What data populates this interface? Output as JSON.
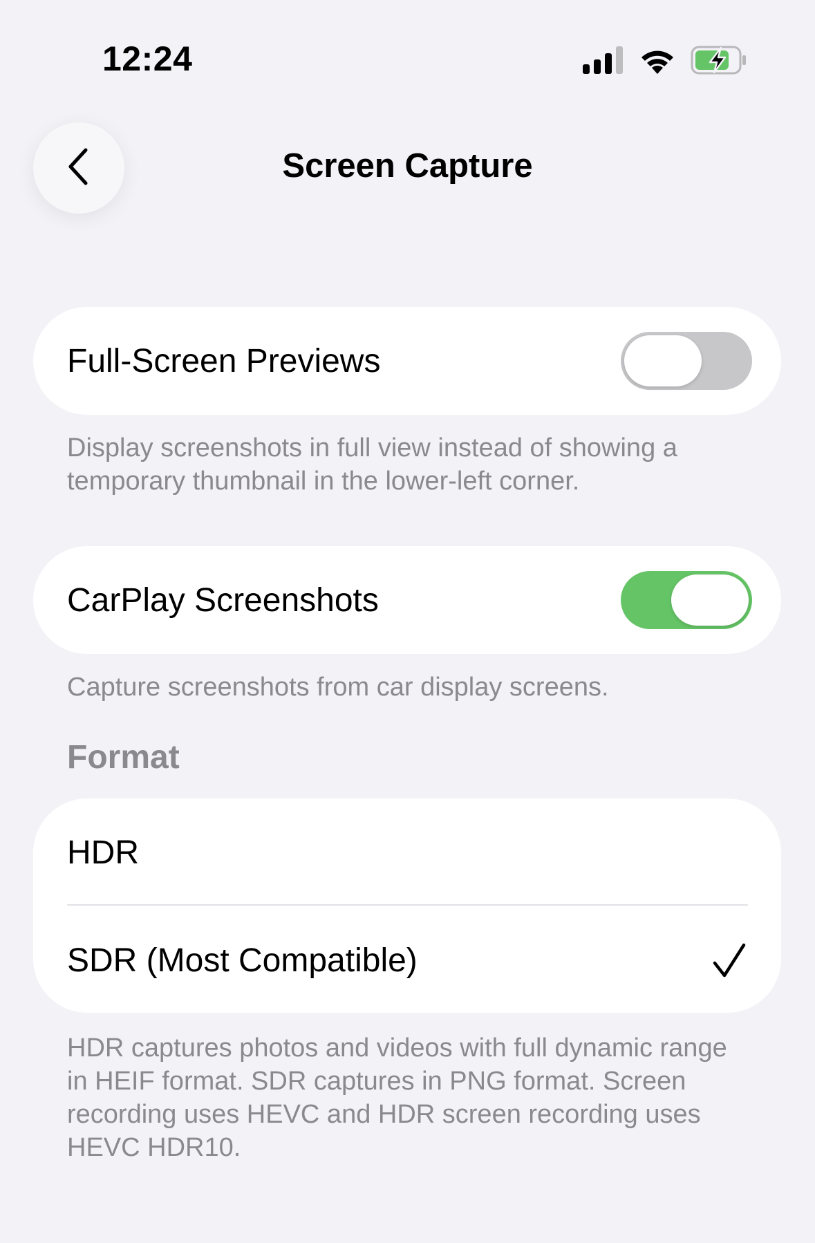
{
  "status_bar": {
    "time": "12:24",
    "signal_icon": "cellular-signal-icon",
    "wifi_icon": "wifi-icon",
    "battery_icon": "battery-charging-icon",
    "battery_color": "#65c466"
  },
  "nav": {
    "back_icon": "chevron-left-icon",
    "title": "Screen Capture"
  },
  "full_screen_previews": {
    "label": "Full-Screen Previews",
    "enabled": false,
    "footer": "Display screenshots in full view instead of showing a temporary thumbnail in the lower-left corner."
  },
  "carplay_screenshots": {
    "label": "CarPlay Screenshots",
    "enabled": true,
    "footer": "Capture screenshots from car display screens."
  },
  "format": {
    "header": "Format",
    "options": [
      {
        "label": "HDR",
        "selected": false
      },
      {
        "label": "SDR (Most Compatible)",
        "selected": true
      }
    ],
    "checkmark_icon": "checkmark-icon",
    "footer": "HDR captures photos and videos with full dynamic range in HEIF format. SDR captures in PNG format. Screen recording uses HEVC and HDR screen recording uses HEVC HDR10."
  },
  "colors": {
    "background": "#f2f2f7",
    "toggle_on": "#65c466",
    "toggle_off": "#c7c7c9",
    "secondary_text": "#8a8a8e"
  }
}
